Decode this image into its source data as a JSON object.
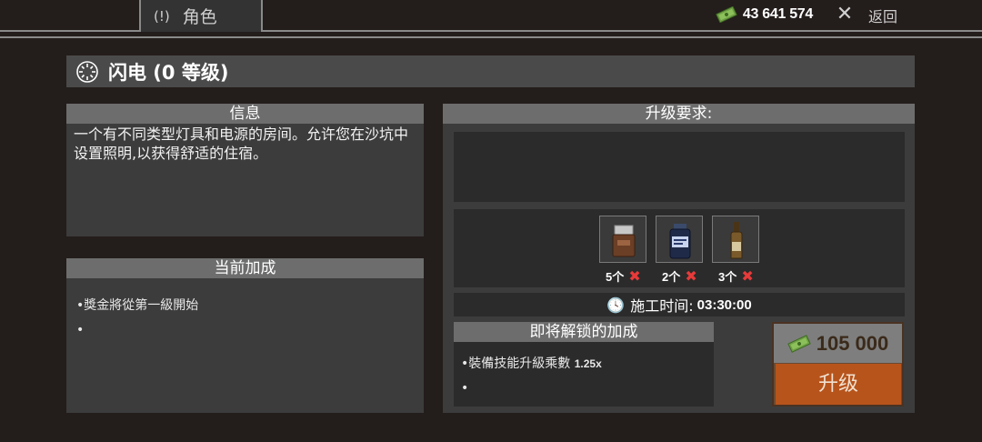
{
  "topbar": {
    "tab_label": "角色",
    "tab_icon": "alert-circle-icon",
    "money": "43 641 574",
    "close_icon": "close-icon",
    "back_label": "返回"
  },
  "title": {
    "icon": "lightning-cog-icon",
    "text": "闪电 (0 等级)"
  },
  "info": {
    "header": "信息",
    "text": "一个有不同类型灯具和电源的房间。允许您在沙坑中设置照明,以获得舒适的住宿。"
  },
  "current_bonus": {
    "header": "当前加成",
    "lines": [
      "獎金將從第一級開始",
      ""
    ]
  },
  "requirements": {
    "header": "升级要求:",
    "items": [
      {
        "icon": "zippo-lighter-icon",
        "qty": "5个"
      },
      {
        "icon": "battery-jar-icon",
        "qty": "2个"
      },
      {
        "icon": "bottle-icon",
        "qty": "3个"
      }
    ],
    "status_icon": "missing-x-icon",
    "construction_label": "施工时间:",
    "construction_time": "03:30:00"
  },
  "unlock_bonus": {
    "header": "即将解锁的加成",
    "lines": [
      "裝備技能升級乘數",
      ""
    ],
    "multiplier": "1.25x"
  },
  "upgrade": {
    "price": "105 000",
    "button_label": "升级"
  },
  "colors": {
    "background": "#231d1b",
    "panel": "#3c3c3c",
    "header": "#6d6d6d",
    "upgrade_button": "#b7541c",
    "missing": "#e83a3a"
  }
}
